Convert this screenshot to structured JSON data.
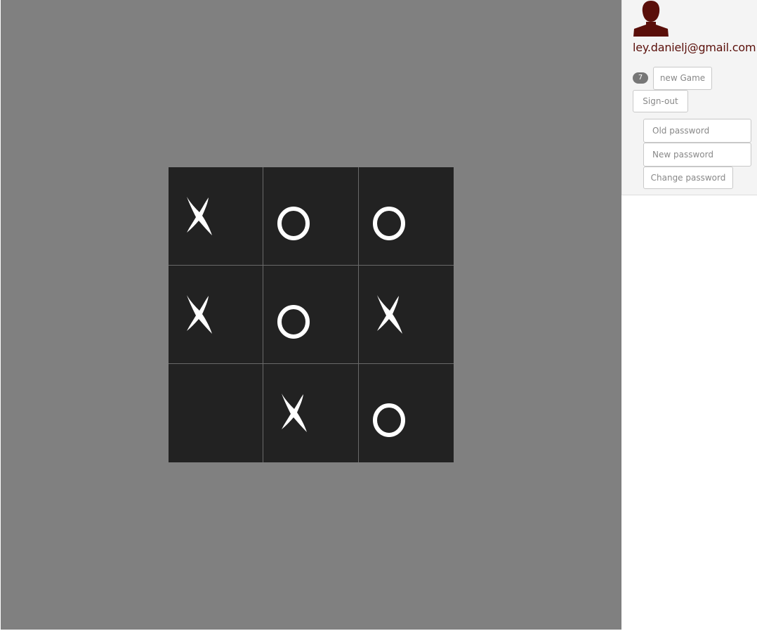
{
  "game": {
    "board": [
      [
        "X",
        "O",
        "O"
      ],
      [
        "X",
        "O",
        "X"
      ],
      [
        "",
        "X",
        "O"
      ]
    ],
    "colors": {
      "background": "#808080",
      "cell": "#222222",
      "mark": "#ffffff"
    }
  },
  "sidebar": {
    "avatar_icon": "user-silhouette-icon",
    "email": "ley.danielj@gmail.com",
    "games_badge": "7",
    "new_game_label": "new Game",
    "sign_out_label": "Sign-out",
    "old_password_placeholder": "Old password",
    "new_password_placeholder": "New password",
    "change_password_label": "Change password",
    "accent_color": "#5a0f0a"
  }
}
